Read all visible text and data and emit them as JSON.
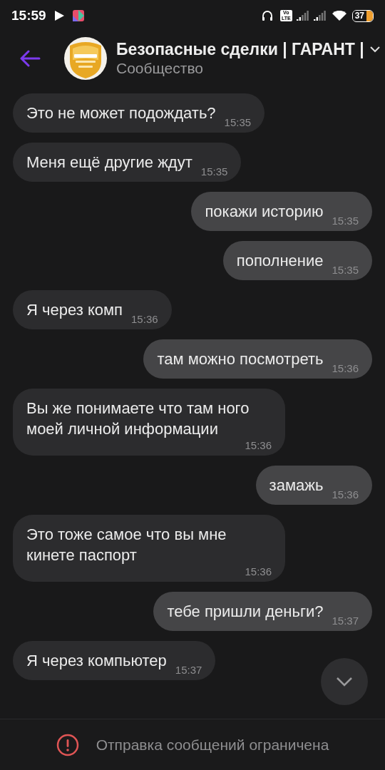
{
  "status_bar": {
    "time": "15:59",
    "volte": [
      "Vo",
      "LTE"
    ],
    "battery": "37"
  },
  "header": {
    "title": "Безопасные сделки | ГАРАНТ |",
    "subtitle": "Сообщество"
  },
  "messages": [
    {
      "outgoing": false,
      "text": "Это не может подождать?",
      "time": "15:35"
    },
    {
      "outgoing": false,
      "text": "Меня ещё другие ждут",
      "time": "15:35"
    },
    {
      "outgoing": true,
      "text": "покажи историю",
      "time": "15:35"
    },
    {
      "outgoing": true,
      "text": "пополнение",
      "time": "15:35"
    },
    {
      "outgoing": false,
      "text": "Я через комп",
      "time": "15:36"
    },
    {
      "outgoing": true,
      "text": "там можно посмотреть",
      "time": "15:36"
    },
    {
      "outgoing": false,
      "text": "Вы же понимаете что там ного моей личной информации",
      "time": "15:36"
    },
    {
      "outgoing": true,
      "text": "замажь",
      "time": "15:36"
    },
    {
      "outgoing": false,
      "text": "Это тоже самое что вы мне кинете паспорт",
      "time": "15:36"
    },
    {
      "outgoing": true,
      "text": "тебе пришли деньги?",
      "time": "15:37"
    },
    {
      "outgoing": false,
      "text": "Я через компьютер",
      "time": "15:37"
    }
  ],
  "notice": "Отправка сообщений ограничена"
}
